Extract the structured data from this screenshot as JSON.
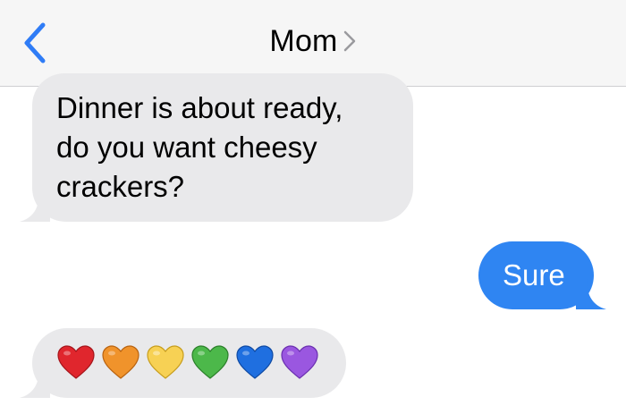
{
  "header": {
    "contact_name": "Mom"
  },
  "messages": [
    {
      "direction": "incoming",
      "lines": [
        "Dinner is about ready,",
        "do you want cheesy",
        "crackers?"
      ]
    },
    {
      "direction": "outgoing",
      "text": "Sure"
    },
    {
      "direction": "incoming",
      "emoji": [
        "red-heart",
        "orange-heart",
        "yellow-heart",
        "green-heart",
        "blue-heart",
        "purple-heart"
      ]
    }
  ],
  "colors": {
    "header_bg": "#f6f6f6",
    "accent_blue": "#2f85f2",
    "back_chevron": "#2f7cf6",
    "incoming_bubble": "#e9e9eb",
    "heart_red": "#e0262d",
    "heart_orange": "#f0932b",
    "heart_yellow": "#f7d154",
    "heart_green": "#4cb84a",
    "heart_blue": "#1f6fe0",
    "heart_purple": "#9a57e0"
  }
}
